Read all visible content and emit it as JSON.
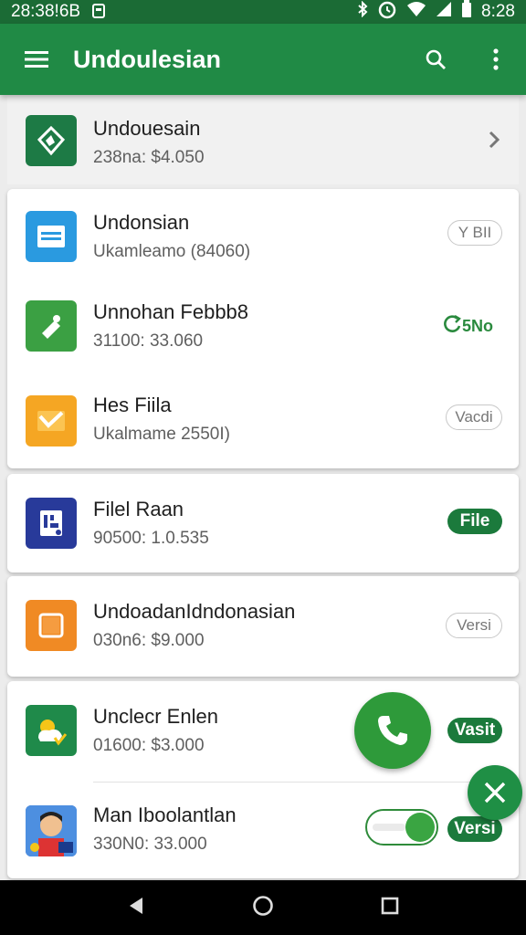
{
  "status_bar": {
    "time": "28:38!6B",
    "clock_right": "8:28"
  },
  "app_bar": {
    "title": "Undoulesian"
  },
  "top_row": {
    "title": "Undouesain",
    "subtitle": "238na: $4.050"
  },
  "card1": {
    "items": [
      {
        "title": "Undonsian",
        "subtitle": "Ukamleamo (84060)",
        "badge": "Y BII"
      },
      {
        "title": "Unnohan Febbb8",
        "subtitle": "31100: 33.060",
        "badge": "5No"
      },
      {
        "title": "Hes Fiila",
        "subtitle": "Ukalmame 2550I)",
        "badge": "Vacdi"
      }
    ]
  },
  "card2": {
    "title": "Filel Raan",
    "subtitle": "90500: 1.0.535",
    "badge": "File"
  },
  "card3": {
    "title": "UndoadanIdndonasian",
    "subtitle": "030n6: $9.000",
    "badge": "Versi"
  },
  "card4": {
    "items": [
      {
        "title": "Unclecr Enlen",
        "subtitle": "01600: $3.000",
        "badge": "Vasit"
      },
      {
        "title": "Man Iboolantlan",
        "subtitle": "330N0: 33.000",
        "badge": "Versi",
        "toggle_on": true
      }
    ]
  },
  "colors": {
    "primary": "#208a45",
    "status": "#1b6b35",
    "accent": "#2e9a3a"
  }
}
